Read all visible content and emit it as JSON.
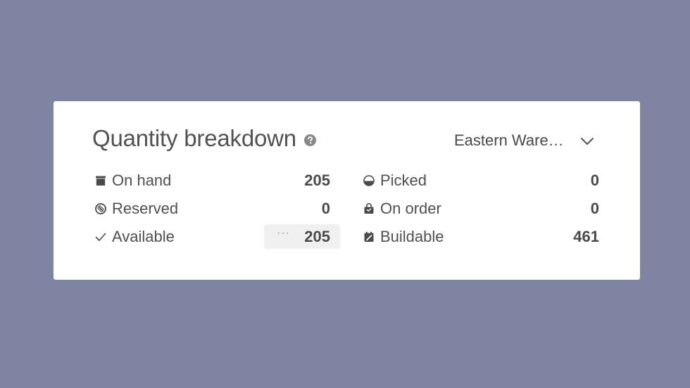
{
  "widget": {
    "title": "Quantity breakdown",
    "location": "Eastern Ware…"
  },
  "left_rows": [
    {
      "label": "On hand",
      "value": "205",
      "icon": "box-icon"
    },
    {
      "label": "Reserved",
      "value": "0",
      "icon": "reserved-icon"
    },
    {
      "label": "Available",
      "value": "205",
      "icon": "check-icon",
      "more": "···"
    }
  ],
  "right_rows": [
    {
      "label": "Picked",
      "value": "0",
      "icon": "picked-icon"
    },
    {
      "label": "On order",
      "value": "0",
      "icon": "shopping-bag-icon"
    },
    {
      "label": "Buildable",
      "value": "461",
      "icon": "buildable-icon"
    }
  ],
  "colors": {
    "background": "#7f84a2",
    "card": "#ffffff",
    "text": "#4a4a4a",
    "highlight": "#f0f0f0"
  }
}
